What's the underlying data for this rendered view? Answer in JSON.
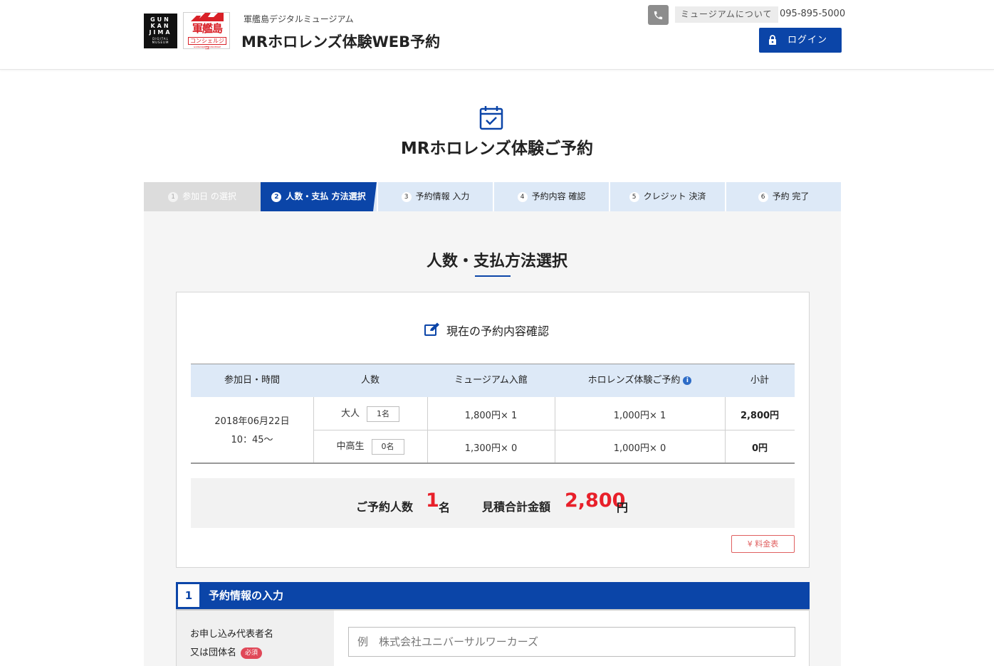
{
  "header": {
    "logo_gkj_big": "GUN KAN JIMA",
    "logo_gkj_small": "DIGITAL MUSEUM",
    "logo_gc_jp": "軍艦島",
    "logo_gc_sub": "コンシェルジュ",
    "logo_gc_en": "GUNKANJIMA CONCIERGE",
    "site_sub": "軍艦島デジタルミュージアム",
    "site_title": "MRホロレンズ体験WEB予約",
    "about": "ミュージアムについて",
    "phone": "095-895-5000",
    "login": "ログイン"
  },
  "page_title": "MRホロレンズ体験ご予約",
  "steps": [
    {
      "num": "1",
      "label": "参加日 の選択"
    },
    {
      "num": "2",
      "label": "人数・支払 方法選択"
    },
    {
      "num": "3",
      "label": "予約情報 入力"
    },
    {
      "num": "4",
      "label": "予約内容 確認"
    },
    {
      "num": "5",
      "label": "クレジット 決済"
    },
    {
      "num": "6",
      "label": "予約 完了"
    }
  ],
  "section_title": "人数・支払方法選択",
  "confirm_heading": "現在の予約内容確認",
  "table": {
    "headers": [
      "参加日・時間",
      "人数",
      "ミュージアム入館",
      "ホロレンズ体験ご予約",
      "小計"
    ],
    "info_icon": "i",
    "date": "2018年06月22日",
    "time": "10：45～",
    "rows": [
      {
        "type": "大人",
        "qty": "1名",
        "museum": "1,800円× 1",
        "holo": "1,000円× 1",
        "subtotal": "2,800円"
      },
      {
        "type": "中高生",
        "qty": "0名",
        "museum": "1,300円× 0",
        "holo": "1,000円× 0",
        "subtotal": "0円"
      }
    ]
  },
  "summary": {
    "people_label": "ご予約人数",
    "people_value": "1",
    "people_unit": "名",
    "total_label": "見積合計金額",
    "total_value": "2,800",
    "total_unit": "円"
  },
  "price_table_button": "¥ 料金表",
  "form": {
    "section_num": "1",
    "section_label": "予約情報の入力",
    "label_line1": "お申し込み代表者名",
    "label_line2": "又は団体名",
    "required": "必須",
    "name_placeholder": "例　株式会社ユニバーサルワーカーズ"
  },
  "colors": {
    "primary": "#0b45a8",
    "accent_red": "#e8202a",
    "step_bg": "#dde9f7"
  }
}
